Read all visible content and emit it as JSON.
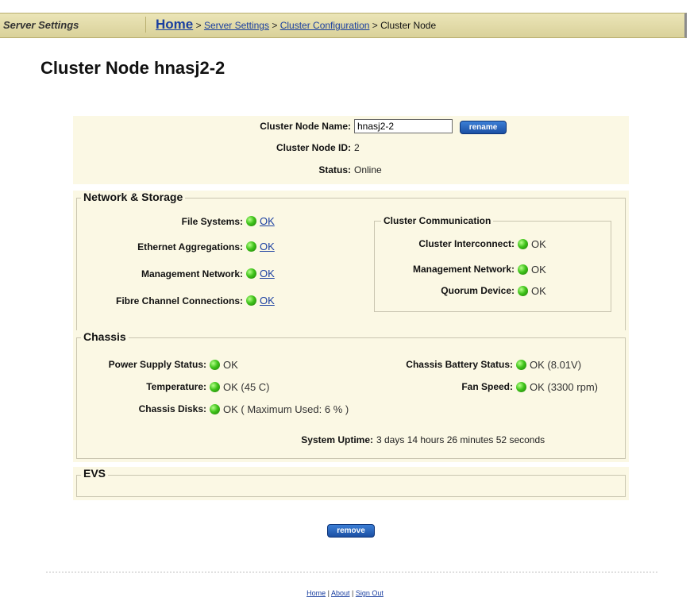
{
  "header": {
    "section": "Server Settings",
    "breadcrumb": {
      "home": "Home",
      "sep": ">",
      "server_settings": "Server Settings",
      "cluster_configuration": "Cluster Configuration",
      "current": "Cluster Node"
    }
  },
  "page_title": "Cluster Node hnasj2-2",
  "node": {
    "name_label": "Cluster Node Name:",
    "name_value": "hnasj2-2",
    "rename_label": "rename",
    "id_label": "Cluster Node ID:",
    "id_value": "2",
    "status_label": "Status:",
    "status_value": "Online"
  },
  "network_storage": {
    "legend": "Network & Storage",
    "items": [
      {
        "label": "File Systems:",
        "value": "OK"
      },
      {
        "label": "Ethernet Aggregations:",
        "value": "OK"
      },
      {
        "label": "Management Network:",
        "value": "OK"
      },
      {
        "label": "Fibre Channel Connections:",
        "value": "OK"
      }
    ],
    "cluster_communication": {
      "legend": "Cluster Communication",
      "items": [
        {
          "label": "Cluster Interconnect:",
          "value": "OK"
        },
        {
          "label": "Management Network:",
          "value": "OK"
        },
        {
          "label": "Quorum Device:",
          "value": "OK"
        }
      ]
    }
  },
  "chassis": {
    "legend": "Chassis",
    "power_supply_label": "Power Supply Status:",
    "power_supply_value": "OK",
    "temperature_label": "Temperature:",
    "temperature_value": "OK (45 C)",
    "disks_label": "Chassis Disks:",
    "disks_value": "OK ( Maximum Used: 6 % )",
    "battery_label": "Chassis Battery Status:",
    "battery_value": "OK (8.01V)",
    "fan_label": "Fan Speed:",
    "fan_value": "OK (3300 rpm)",
    "uptime_label": "System Uptime:",
    "uptime_value": "3 days 14 hours 26 minutes 52 seconds"
  },
  "evs": {
    "legend": "EVS"
  },
  "remove_label": "remove",
  "footer": {
    "home": "Home",
    "about": "About",
    "signout": "Sign Out",
    "sep": "|"
  },
  "colors": {
    "led": "#3fc31a",
    "link": "#1a3fa0",
    "panel_bg": "#fbf8e4",
    "header_bg": "#e3dba8"
  }
}
